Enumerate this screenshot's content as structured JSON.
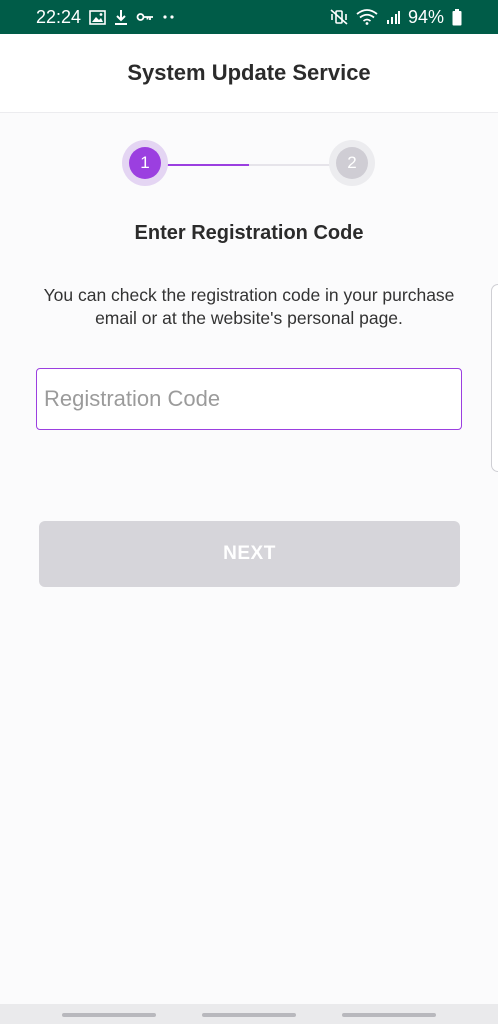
{
  "status_bar": {
    "time": "22:24",
    "left_icons": [
      "image-icon",
      "download-icon",
      "key-icon",
      "more-dots-icon"
    ],
    "right_icons": [
      "mute-vibrate-icon",
      "wifi-icon",
      "signal-icon",
      "battery-icon"
    ],
    "battery": "94%",
    "background_color": "#005c48"
  },
  "header": {
    "title": "System Update Service"
  },
  "stepper": {
    "steps": [
      {
        "label": "1",
        "state": "active"
      },
      {
        "label": "2",
        "state": "inactive"
      }
    ],
    "progress": 0.5,
    "accent_color": "#9b3fe0"
  },
  "form": {
    "heading": "Enter Registration Code",
    "instructions": "You can check the registration code in your purchase email or at the website's personal page.",
    "code_input": {
      "value": "",
      "placeholder": "Registration Code"
    },
    "next_button": {
      "label": "NEXT",
      "enabled": false
    }
  }
}
